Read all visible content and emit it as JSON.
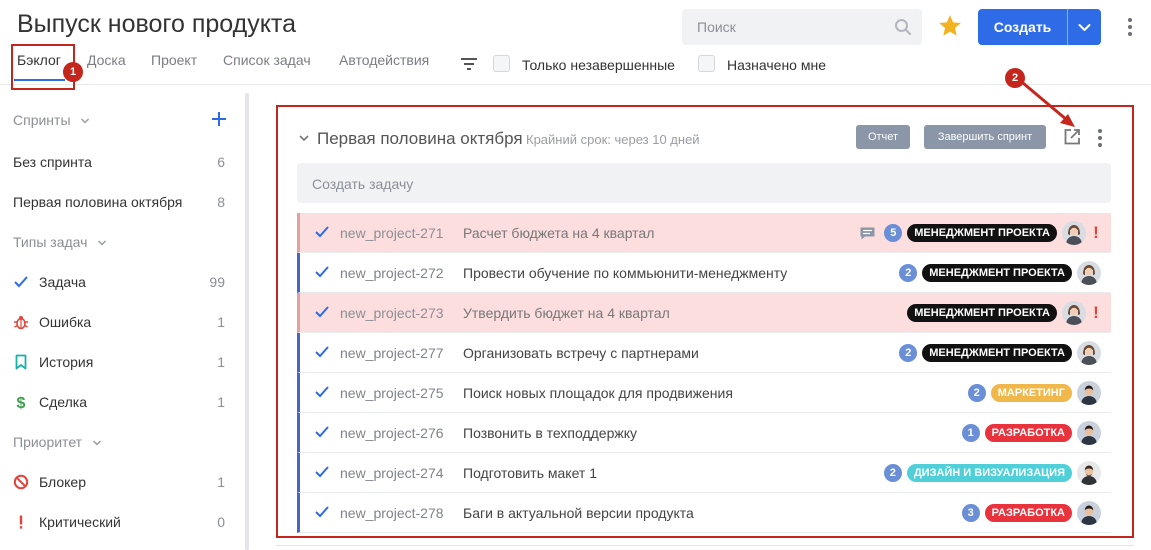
{
  "header": {
    "title": "Выпуск нового продукта",
    "search_placeholder": "Поиск",
    "create_label": "Создать"
  },
  "tabs": [
    {
      "label": "Бэклог",
      "active": true
    },
    {
      "label": "Доска"
    },
    {
      "label": "Проект"
    },
    {
      "label": "Список задач"
    },
    {
      "label": "Автодействия"
    }
  ],
  "filters": {
    "unfinished_label": "Только незавершенные",
    "assigned_label": "Назначено мне"
  },
  "annotations": [
    "1",
    "2"
  ],
  "sidebar": {
    "sprints_title": "Спринты",
    "sprints": [
      {
        "label": "Без спринта",
        "count": "6"
      },
      {
        "label": "Первая половина октября",
        "count": "8"
      }
    ],
    "types_title": "Типы задач",
    "types": [
      {
        "label": "Задача",
        "count": "99",
        "icon": "check-icon",
        "color": "#2e6be6"
      },
      {
        "label": "Ошибка",
        "count": "1",
        "icon": "bug-icon",
        "color": "#e2443a"
      },
      {
        "label": "История",
        "count": "1",
        "icon": "bookmark-icon",
        "color": "#19b3a6"
      },
      {
        "label": "Сделка",
        "count": "1",
        "icon": "dollar-icon",
        "color": "#3aa04a"
      }
    ],
    "priority_title": "Приоритет",
    "priorities": [
      {
        "label": "Блокер",
        "count": "1",
        "icon": "blocker-icon",
        "color": "#e2443a"
      },
      {
        "label": "Критический",
        "count": "0",
        "icon": "exclamation-icon",
        "color": "#e2443a"
      }
    ]
  },
  "sprint": {
    "title": "Первая половина октября",
    "deadline": "Крайний срок: через 10 дней",
    "report_label": "Отчет",
    "finish_label": "Завершить спринт",
    "create_task_placeholder": "Создать задачу"
  },
  "colors": {
    "accent": "#2e6be6",
    "annotation": "#c4261d",
    "label_management": "#111111",
    "label_marketing": "#f0b84a",
    "label_development": "#e8323c",
    "label_design": "#4fd0d8"
  },
  "tasks": [
    {
      "key": "new_project-271",
      "name": "Расчет бюджета на 4 квартал",
      "highlight": true,
      "comment": true,
      "count": "5",
      "label": "МЕНЕДЖМЕНТ ПРОЕКТА",
      "label_color": "#111111",
      "avatar": "woman",
      "critical": "!"
    },
    {
      "key": "new_project-272",
      "name": "Провести обучение по коммьюнити-менеджменту",
      "highlight": false,
      "comment": false,
      "count": "2",
      "label": "МЕНЕДЖМЕНТ ПРОЕКТА",
      "label_color": "#111111",
      "avatar": "woman",
      "critical": ""
    },
    {
      "key": "new_project-273",
      "name": "Утвердить бюджет на 4 квартал",
      "highlight": true,
      "comment": false,
      "count": "",
      "label": "МЕНЕДЖМЕНТ ПРОЕКТА",
      "label_color": "#111111",
      "avatar": "woman",
      "critical": "!"
    },
    {
      "key": "new_project-277",
      "name": "Организовать встречу с партнерами",
      "highlight": false,
      "comment": false,
      "count": "2",
      "label": "МЕНЕДЖМЕНТ ПРОЕКТА",
      "label_color": "#111111",
      "avatar": "woman",
      "critical": ""
    },
    {
      "key": "new_project-275",
      "name": "Поиск новых площадок для продвижения",
      "highlight": false,
      "comment": false,
      "count": "2",
      "label": "МАРКЕТИНГ",
      "label_color": "#f0b84a",
      "avatar": "man",
      "critical": ""
    },
    {
      "key": "new_project-276",
      "name": "Позвонить в техподдержку",
      "highlight": false,
      "comment": false,
      "count": "1",
      "label": "РАЗРАБОТКА",
      "label_color": "#e8323c",
      "avatar": "man",
      "critical": ""
    },
    {
      "key": "new_project-274",
      "name": "Подготовить макет 1",
      "highlight": false,
      "comment": false,
      "count": "2",
      "label": "ДИЗАЙН И ВИЗУАЛИЗАЦИЯ",
      "label_color": "#4fd0d8",
      "avatar": "man2",
      "critical": ""
    },
    {
      "key": "new_project-278",
      "name": "Баги в актуальной версии продукта",
      "highlight": false,
      "comment": false,
      "count": "3",
      "label": "РАЗРАБОТКА",
      "label_color": "#e8323c",
      "avatar": "man",
      "critical": ""
    }
  ]
}
